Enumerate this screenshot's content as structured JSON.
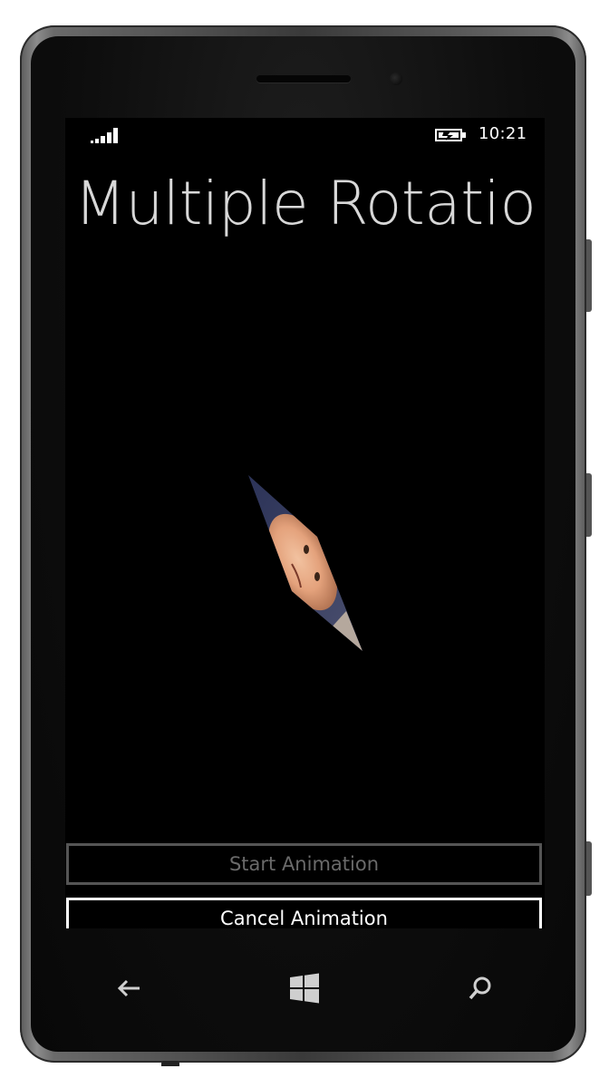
{
  "status_bar": {
    "signal_icon": "signal-strength-icon",
    "battery_icon": "battery-charging-icon",
    "time": "10:21"
  },
  "page": {
    "title": "Multiple Rotatio"
  },
  "buttons": {
    "start_label": "Start Animation",
    "cancel_label": "Cancel Animation"
  },
  "nav_bar": {
    "back_icon": "back-arrow-icon",
    "start_icon": "windows-logo-icon",
    "search_icon": "search-icon"
  },
  "colors": {
    "background": "#000000",
    "title": "#d8d8d8",
    "disabled_button": "#555555",
    "active_button": "#ffffff"
  }
}
